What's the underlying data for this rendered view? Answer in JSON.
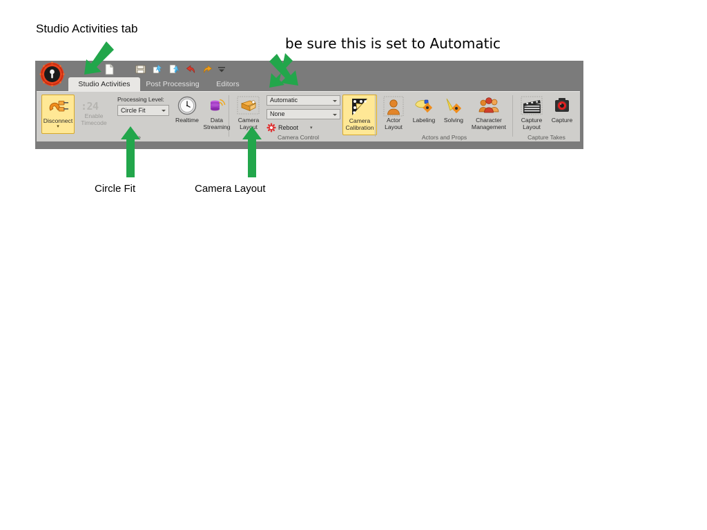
{
  "annotations": [
    {
      "id": "studio",
      "text": "Studio Activities tab"
    },
    {
      "id": "automatic",
      "text": "be sure this is set to Automatic"
    },
    {
      "id": "circlefit",
      "text": "Circle Fit"
    },
    {
      "id": "cameralayout",
      "text": "Camera Layout"
    }
  ],
  "arrow_color": "#22a64b",
  "ribbon": {
    "app_button": {
      "name": "application-menu-button"
    },
    "quick_access": [
      {
        "icon": "new-document-icon",
        "label": "New"
      },
      {
        "icon": "save-icon",
        "label": "Save"
      },
      {
        "icon": "import-icon",
        "label": "Import"
      },
      {
        "icon": "export-icon",
        "label": "Export"
      },
      {
        "icon": "undo-icon",
        "label": "Undo"
      },
      {
        "icon": "redo-icon",
        "label": "Redo"
      },
      {
        "icon": "customize-quick-access-icon",
        "label": "Customize Quick Access Toolbar"
      }
    ],
    "tabs": [
      {
        "label": "Studio Activities",
        "active": true
      },
      {
        "label": "Post Processing",
        "active": false
      },
      {
        "label": "Editors",
        "active": false
      }
    ],
    "groups": [
      {
        "title": "Go Live",
        "title_visible": "o Live",
        "buttons": [
          {
            "label": "Disconnect",
            "icon": "disconnect-plug-icon",
            "state": "selected",
            "has_dropdown": true
          },
          {
            "label": "Enable Timecode",
            "icon": "timecode-icon",
            "state": "disabled",
            "has_dropdown": true
          }
        ],
        "timecode_value": ":24",
        "field_label": "Processing Level:",
        "processing_level": {
          "value": "Circle Fit",
          "options": [
            "Circle Fit"
          ]
        },
        "extra_buttons": [
          {
            "label": "Realtime",
            "icon": "clock-icon"
          },
          {
            "label": "Data Streaming",
            "icon": "data-streaming-icon"
          }
        ]
      },
      {
        "title": "Camera Control",
        "buttons": [
          {
            "label": "Camera Layout",
            "icon": "camera-layout-icon"
          },
          {
            "label": "Camera Calibration",
            "icon": "calibration-wand-icon",
            "state": "selected"
          }
        ],
        "combo_1": {
          "value": "Automatic",
          "options": [
            "Automatic"
          ]
        },
        "combo_2": {
          "value": "None",
          "options": [
            "None"
          ]
        },
        "reboot": {
          "label": "Reboot",
          "icon": "reboot-icon",
          "has_dropdown": true
        }
      },
      {
        "title": "Actors and Props",
        "buttons": [
          {
            "label": "Actor Layout",
            "icon": "actor-layout-icon"
          },
          {
            "label": "Labeling",
            "icon": "labeling-icon"
          },
          {
            "label": "Solving",
            "icon": "solving-icon"
          },
          {
            "label": "Character Management",
            "icon": "character-management-icon"
          }
        ]
      },
      {
        "title": "Capture Takes",
        "buttons": [
          {
            "label": "Capture Layout",
            "icon": "clapperboard-icon"
          },
          {
            "label": "Capture",
            "icon": "record-camera-icon"
          }
        ]
      }
    ]
  },
  "colors": {
    "ribbon_bg": "#7b7b7b",
    "ribbon_body": "#cfcecb",
    "tab_active_bg": "#e8e7e4",
    "selected_button": "#ffe896",
    "accent_green": "#22a64b"
  }
}
